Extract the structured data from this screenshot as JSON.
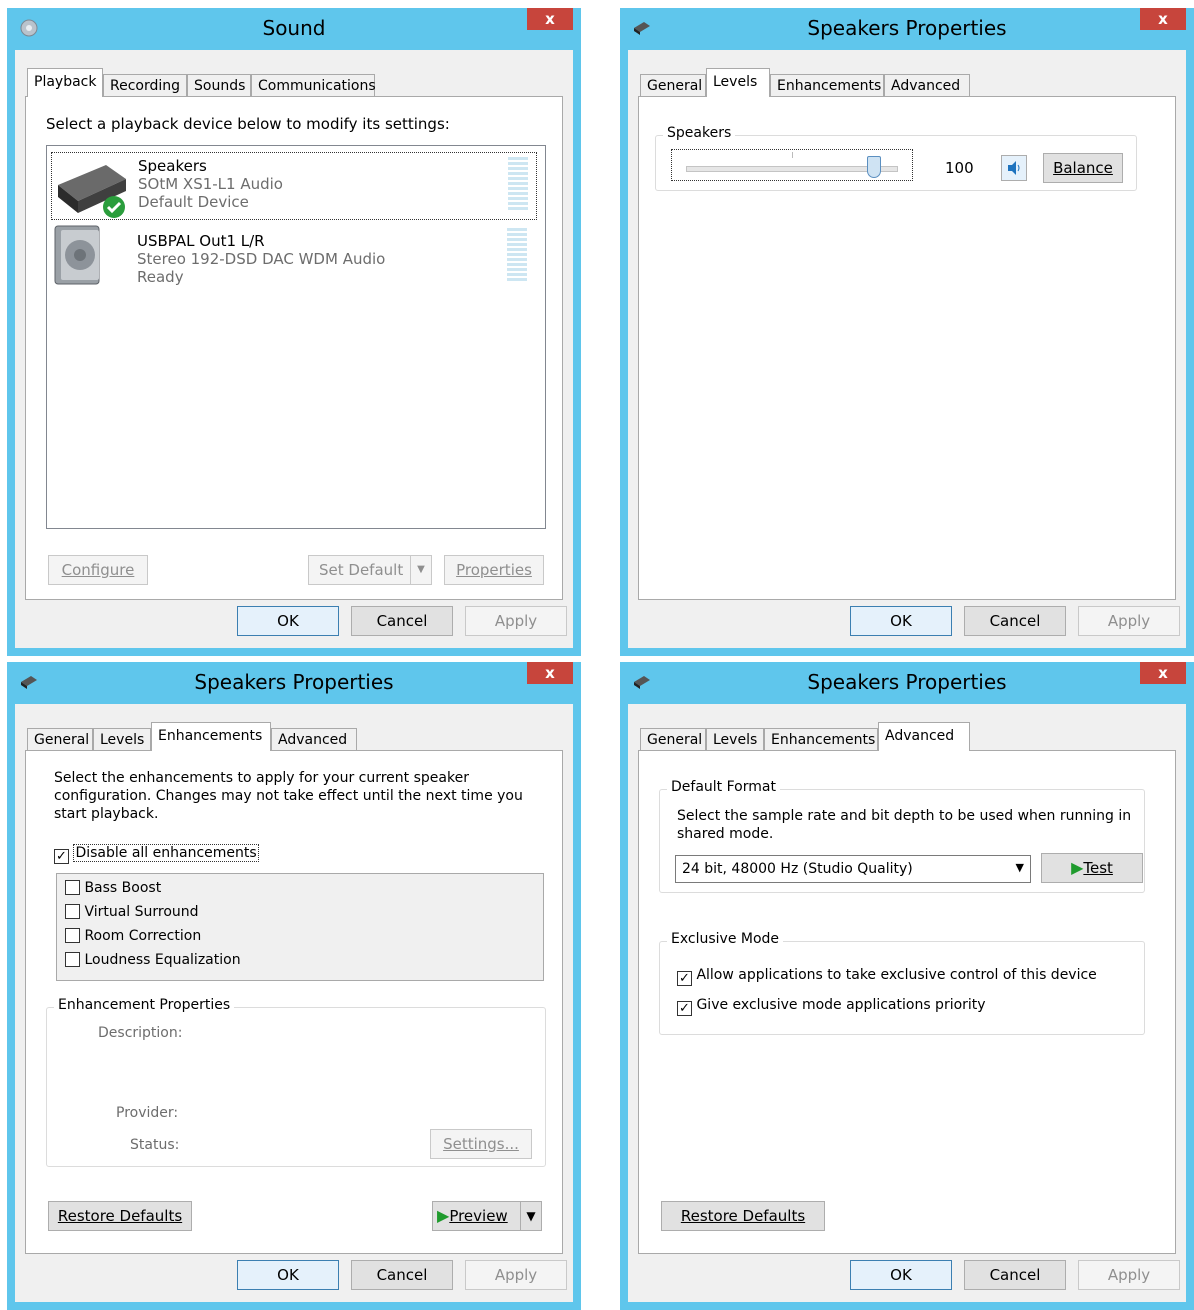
{
  "sound": {
    "title": "Sound",
    "close": "x",
    "tabs": [
      "Playback",
      "Recording",
      "Sounds",
      "Communications"
    ],
    "instruction": "Select a playback device below to modify its settings:",
    "devices": [
      {
        "name": "Speakers",
        "line2": "SOtM XS1-L1 Audio",
        "line3": "Default Device"
      },
      {
        "name": "USBPAL Out1 L/R",
        "line2": "Stereo 192-DSD DAC WDM Audio",
        "line3": "Ready"
      }
    ],
    "configure": "Configure",
    "set_default": "Set Default",
    "properties": "Properties",
    "ok": "OK",
    "cancel": "Cancel",
    "apply": "Apply"
  },
  "props_title": "Speakers Properties",
  "props_tabs": [
    "General",
    "Levels",
    "Enhancements",
    "Advanced"
  ],
  "levels": {
    "group": "Speakers",
    "value": "100",
    "level_fraction": 1.0,
    "balance": "Balance"
  },
  "enh": {
    "intro": "Select the enhancements to apply for your current speaker configuration. Changes may not take effect until the next time you start playback.",
    "disable_all": "Disable all enhancements",
    "items": [
      "Bass Boost",
      "Virtual Surround",
      "Room Correction",
      "Loudness Equalization"
    ],
    "props_group": "Enhancement Properties",
    "description": "Description:",
    "provider": "Provider:",
    "status": "Status:",
    "settings": "Settings...",
    "restore": "Restore Defaults",
    "preview": "Preview"
  },
  "adv": {
    "default_format": "Default Format",
    "format_desc": "Select the sample rate and bit depth to be used when running in shared mode.",
    "format_value": "24 bit, 48000 Hz (Studio Quality)",
    "test": "Test",
    "exclusive": "Exclusive Mode",
    "allow_exclusive": "Allow applications to take exclusive control of this device",
    "priority": "Give exclusive mode applications priority",
    "restore": "Restore Defaults"
  },
  "colors": {
    "titlebar": "#5fc6ec",
    "close": "#c7453c",
    "check_green": "#2a9d3c",
    "play_green": "#1f9b2d"
  }
}
